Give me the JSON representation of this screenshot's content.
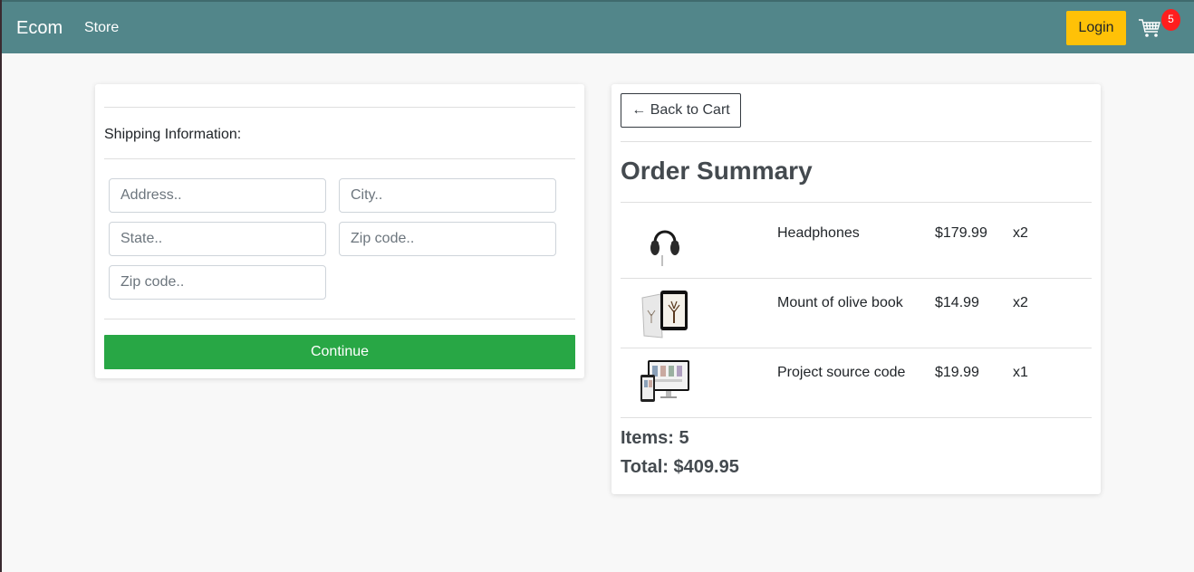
{
  "navbar": {
    "brand": "Ecom",
    "store_link": "Store",
    "login_label": "Login",
    "cart_icon": "shopping-cart-icon",
    "cart_count": "5"
  },
  "shipping": {
    "title": "Shipping Information:",
    "fields": {
      "address_placeholder": "Address..",
      "city_placeholder": "City..",
      "state_placeholder": "State..",
      "zip_placeholder": "Zip code..",
      "zip2_placeholder": "Zip code.."
    },
    "continue_label": "Continue"
  },
  "summary": {
    "back_label": "← Back to Cart",
    "title": "Order Summary",
    "items": [
      {
        "image_icon": "headphones-image",
        "name": "Headphones",
        "price": "$179.99",
        "qty": "x2"
      },
      {
        "image_icon": "book-tablet-image",
        "name": "Mount of olive book",
        "price": "$14.99",
        "qty": "x2"
      },
      {
        "image_icon": "devices-image",
        "name": "Project source code",
        "price": "$19.99",
        "qty": "x1"
      }
    ],
    "items_label": "Items:",
    "items_count": "5",
    "total_label": "Total:",
    "total_value": "$409.95"
  },
  "colors": {
    "navbar": "#52868a",
    "login": "#ffc107",
    "continue": "#28a745",
    "badge": "#ff1e1e"
  }
}
